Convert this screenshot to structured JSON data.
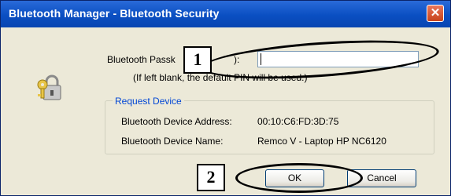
{
  "window": {
    "title": "Bluetooth Manager - Bluetooth Security"
  },
  "icons": {
    "dialog": "key-lock-icon",
    "close": "close-icon"
  },
  "passkey": {
    "label_visible": "Bluetooth Passk",
    "label_suffix": "):",
    "value": "",
    "hint": "(If left blank, the default PIN will be used.)"
  },
  "request_device": {
    "legend": "Request Device",
    "address_label": "Bluetooth Device Address:",
    "address_value": "00:10:C6:FD:3D:75",
    "name_label": "Bluetooth Device Name:",
    "name_value": "Remco V - Laptop HP NC6120"
  },
  "buttons": {
    "ok": "OK",
    "cancel": "Cancel"
  },
  "annotations": {
    "marker1": "1",
    "marker2": "2"
  },
  "colors": {
    "title_bar": "#0a4fc2",
    "legend_text": "#0046d5",
    "dialog_bg": "#ece9d8"
  }
}
